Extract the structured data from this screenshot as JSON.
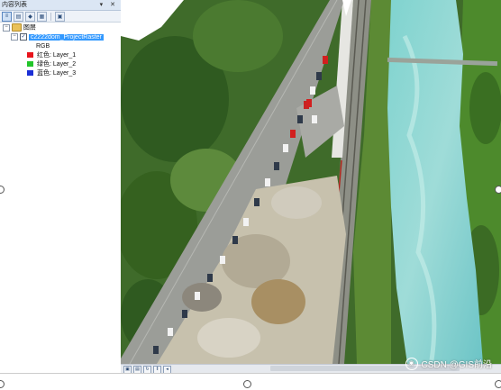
{
  "toc": {
    "title": "内容列表",
    "title_controls": "▾ ✕",
    "root_label": "图层",
    "layer_name": "c2222dom_ProjectRaster",
    "rgb_label": "RGB",
    "bands": [
      {
        "color": "#e8141c",
        "label": "红色:",
        "layer": "Layer_1"
      },
      {
        "color": "#22c52a",
        "label": "绿色:",
        "layer": "Layer_2"
      },
      {
        "color": "#1b2fd6",
        "label": "蓝色:",
        "layer": "Layer_3"
      }
    ]
  },
  "watermark": {
    "text": "CSDN @GIS前沿"
  }
}
